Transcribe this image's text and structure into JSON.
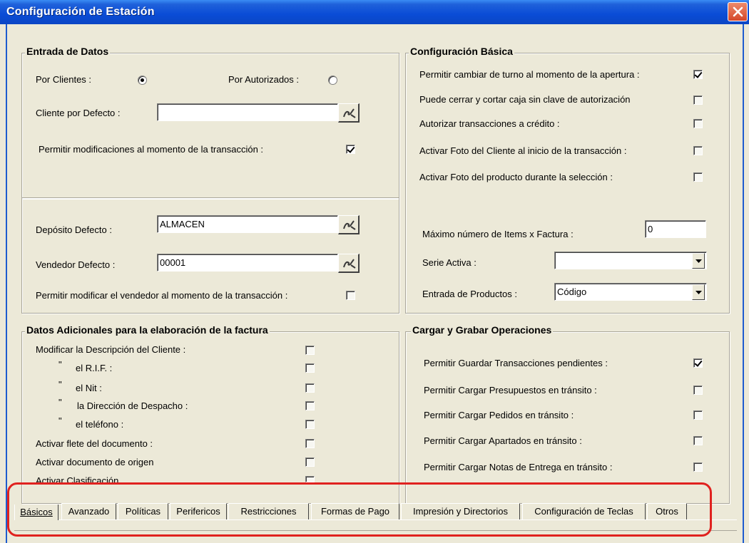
{
  "window": {
    "title": "Configuración de Estación"
  },
  "entrada": {
    "legend": "Entrada de Datos",
    "por_clientes_label": "Por Clientes :",
    "por_autorizados_label": "Por Autorizados :",
    "cliente_defecto_label": "Cliente por Defecto :",
    "cliente_defecto_value": "",
    "permitir_mod_label": "Permitir modificaciones al momento de la transacción :"
  },
  "deposito": {
    "deposito_label": "Depósito Defecto :",
    "deposito_value": "ALMACEN",
    "vendedor_label": "Vendedor Defecto :",
    "vendedor_value": "00001",
    "permitir_vendedor_label": "Permitir modificar el vendedor al momento de la transacción :"
  },
  "basica": {
    "legend": "Configuración Básica",
    "items": [
      {
        "label": "Permitir cambiar de turno al momento de la apertura :",
        "checked": true
      },
      {
        "label": "Puede cerrar y cortar caja sin clave de autorización",
        "checked": false
      },
      {
        "label": "Autorizar transacciones a crédito :",
        "checked": false
      },
      {
        "label": "Activar Foto del Cliente al inicio de la transacción :",
        "checked": false
      },
      {
        "label": "Activar Foto del producto durante la selección :",
        "checked": false
      }
    ],
    "max_items_label": "Máximo número de Items x Factura :",
    "max_items_value": "0",
    "serie_label": "Serie Activa :",
    "serie_value": "",
    "entrada_prod_label": "Entrada de Productos :",
    "entrada_prod_value": "Código"
  },
  "adicionales": {
    "legend": "Datos Adicionales para la elaboración de la factura",
    "items": [
      {
        "label": "Modificar la Descripción del Cliente :"
      },
      {
        "mark": "\"",
        "label": "el R.I.F.  :"
      },
      {
        "mark": "\"",
        "label": "el Nit  :"
      },
      {
        "mark": "\"",
        "label": "la Dirección de Despacho  :"
      },
      {
        "mark": "\"",
        "label": "el teléfono  :"
      },
      {
        "label": "Activar flete del documento :"
      },
      {
        "label": "Activar documento de origen"
      },
      {
        "label": "Activar Clasificación"
      }
    ]
  },
  "cargar": {
    "legend": "Cargar y Grabar Operaciones",
    "items": [
      {
        "label": "Permitir Guardar Transacciones pendientes :",
        "checked": true
      },
      {
        "label": "Permitir Cargar Presupuestos en tránsito :",
        "checked": false
      },
      {
        "label": "Permitir Cargar Pedidos en tránsito :",
        "checked": false
      },
      {
        "label": "Permitir Cargar Apartados en tránsito :",
        "checked": false
      },
      {
        "label": "Permitir Cargar Notas de Entrega en tránsito :",
        "checked": false
      }
    ]
  },
  "tabs": [
    {
      "label": "Básicos"
    },
    {
      "label": "Avanzado"
    },
    {
      "label": "Políticas"
    },
    {
      "label": "Perifericos"
    },
    {
      "label": "Restricciones"
    },
    {
      "label": "Formas de Pago"
    },
    {
      "label": "Impresión y Directorios"
    },
    {
      "label": "Configuración de Teclas"
    },
    {
      "label": "Otros"
    }
  ]
}
